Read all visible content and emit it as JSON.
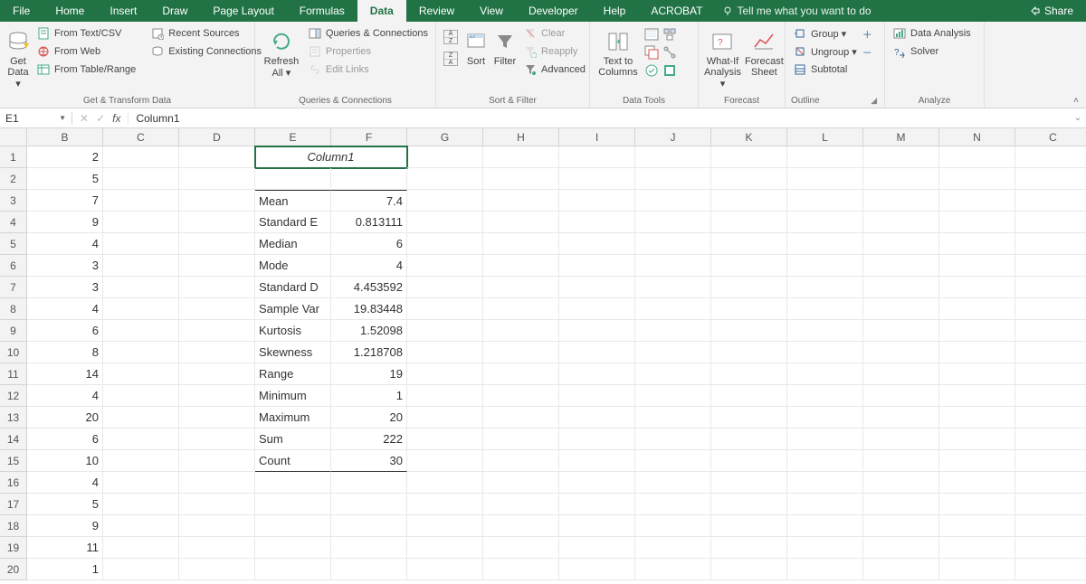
{
  "menu": {
    "tabs": [
      "File",
      "Home",
      "Insert",
      "Draw",
      "Page Layout",
      "Formulas",
      "Data",
      "Review",
      "View",
      "Developer",
      "Help",
      "ACROBAT"
    ],
    "active": "Data",
    "tell": "Tell me what you want to do",
    "share": "Share"
  },
  "ribbon": {
    "groups": [
      {
        "label": "Get & Transform Data",
        "big": {
          "label": "Get Data ▾"
        },
        "items": [
          "From Text/CSV",
          "From Web",
          "From Table/Range",
          "Recent Sources",
          "Existing Connections"
        ]
      },
      {
        "label": "Queries & Connections",
        "big": {
          "label": "Refresh All ▾"
        },
        "items": [
          "Queries & Connections",
          "Properties",
          "Edit Links"
        ]
      },
      {
        "label": "Sort & Filter",
        "big1": {
          "label": "Sort"
        },
        "big2": {
          "label": "Filter"
        },
        "items": [
          "Clear",
          "Reapply",
          "Advanced"
        ]
      },
      {
        "label": "Data Tools",
        "big": {
          "label": "Text to Columns"
        }
      },
      {
        "label": "Forecast",
        "big1": {
          "label": "What-If Analysis ▾"
        },
        "big2": {
          "label": "Forecast Sheet"
        }
      },
      {
        "label": "Outline",
        "items": [
          "Group  ▾",
          "Ungroup  ▾",
          "Subtotal"
        ]
      },
      {
        "label": "Analyze",
        "items": [
          "Data Analysis",
          "Solver"
        ]
      }
    ],
    "sort_icons": {
      "az": "A↓Z",
      "za": "Z↓A"
    }
  },
  "formula_bar": {
    "name_box": "E1",
    "fx": "fx",
    "value": "Column1"
  },
  "sheet": {
    "columns": [
      "B",
      "C",
      "D",
      "E",
      "F",
      "G",
      "H",
      "I",
      "J",
      "K",
      "L",
      "M",
      "N",
      "C"
    ],
    "rows": 20,
    "colB": [
      2,
      5,
      7,
      9,
      4,
      3,
      3,
      4,
      6,
      8,
      14,
      4,
      20,
      6,
      10,
      4,
      5,
      9,
      11,
      1
    ],
    "stats_title": "Column1",
    "stats": [
      {
        "label": "Mean",
        "value": "7.4"
      },
      {
        "label": "Standard E",
        "value": "0.813111"
      },
      {
        "label": "Median",
        "value": "6"
      },
      {
        "label": "Mode",
        "value": "4"
      },
      {
        "label": "Standard D",
        "value": "4.453592"
      },
      {
        "label": "Sample Var",
        "value": "19.83448"
      },
      {
        "label": "Kurtosis",
        "value": "1.52098"
      },
      {
        "label": "Skewness",
        "value": "1.218708"
      },
      {
        "label": "Range",
        "value": "19"
      },
      {
        "label": "Minimum",
        "value": "1"
      },
      {
        "label": "Maximum",
        "value": "20"
      },
      {
        "label": "Sum",
        "value": "222"
      },
      {
        "label": "Count",
        "value": "30"
      }
    ]
  }
}
